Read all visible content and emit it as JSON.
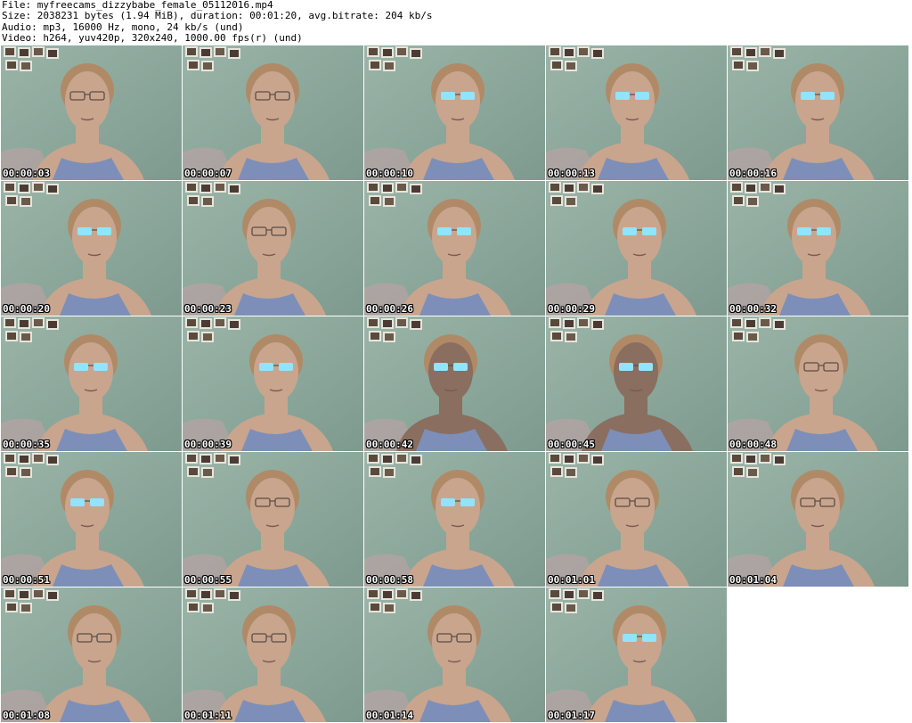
{
  "header": {
    "file": "File: myfreecams_dizzybabe_female_05112016.mp4",
    "size": "Size: 2038231 bytes (1.94 MiB), duration: 00:01:20, avg.bitrate: 204 kb/s",
    "audio": "Audio: mp3, 16000 Hz, mono, 24 kb/s (und)",
    "video": "Video: h264, yuv420p, 320x240, 1000.00 fps(r) (und)"
  },
  "thumbnails": [
    {
      "timestamp": "00:00:03",
      "glow": false,
      "dark": false
    },
    {
      "timestamp": "00:00:07",
      "glow": false,
      "dark": false
    },
    {
      "timestamp": "00:00:10",
      "glow": true,
      "dark": false
    },
    {
      "timestamp": "00:00:13",
      "glow": true,
      "dark": false
    },
    {
      "timestamp": "00:00:16",
      "glow": true,
      "dark": false
    },
    {
      "timestamp": "00:00:20",
      "glow": true,
      "dark": false
    },
    {
      "timestamp": "00:00:23",
      "glow": false,
      "dark": false
    },
    {
      "timestamp": "00:00:26",
      "glow": true,
      "dark": false
    },
    {
      "timestamp": "00:00:29",
      "glow": true,
      "dark": false
    },
    {
      "timestamp": "00:00:32",
      "glow": true,
      "dark": false
    },
    {
      "timestamp": "00:00:35",
      "glow": true,
      "dark": false
    },
    {
      "timestamp": "00:00:39",
      "glow": true,
      "dark": false
    },
    {
      "timestamp": "00:00:42",
      "glow": true,
      "dark": true
    },
    {
      "timestamp": "00:00:45",
      "glow": true,
      "dark": true
    },
    {
      "timestamp": "00:00:48",
      "glow": false,
      "dark": false
    },
    {
      "timestamp": "00:00:51",
      "glow": true,
      "dark": false
    },
    {
      "timestamp": "00:00:55",
      "glow": false,
      "dark": false
    },
    {
      "timestamp": "00:00:58",
      "glow": true,
      "dark": false
    },
    {
      "timestamp": "00:01:01",
      "glow": false,
      "dark": false
    },
    {
      "timestamp": "00:01:04",
      "glow": false,
      "dark": false
    },
    {
      "timestamp": "00:01:08",
      "glow": false,
      "dark": false
    },
    {
      "timestamp": "00:01:11",
      "glow": false,
      "dark": false
    },
    {
      "timestamp": "00:01:14",
      "glow": false,
      "dark": false
    },
    {
      "timestamp": "00:01:17",
      "glow": true,
      "dark": false
    }
  ],
  "colors": {
    "wall": "#9ab5a8",
    "wall_dark": "#7e9a8e",
    "skin": "#c9a58e",
    "skin_dark": "#8a6e5f",
    "top": "#7d8fb8",
    "glasses_glow": "#8fe4ff"
  }
}
